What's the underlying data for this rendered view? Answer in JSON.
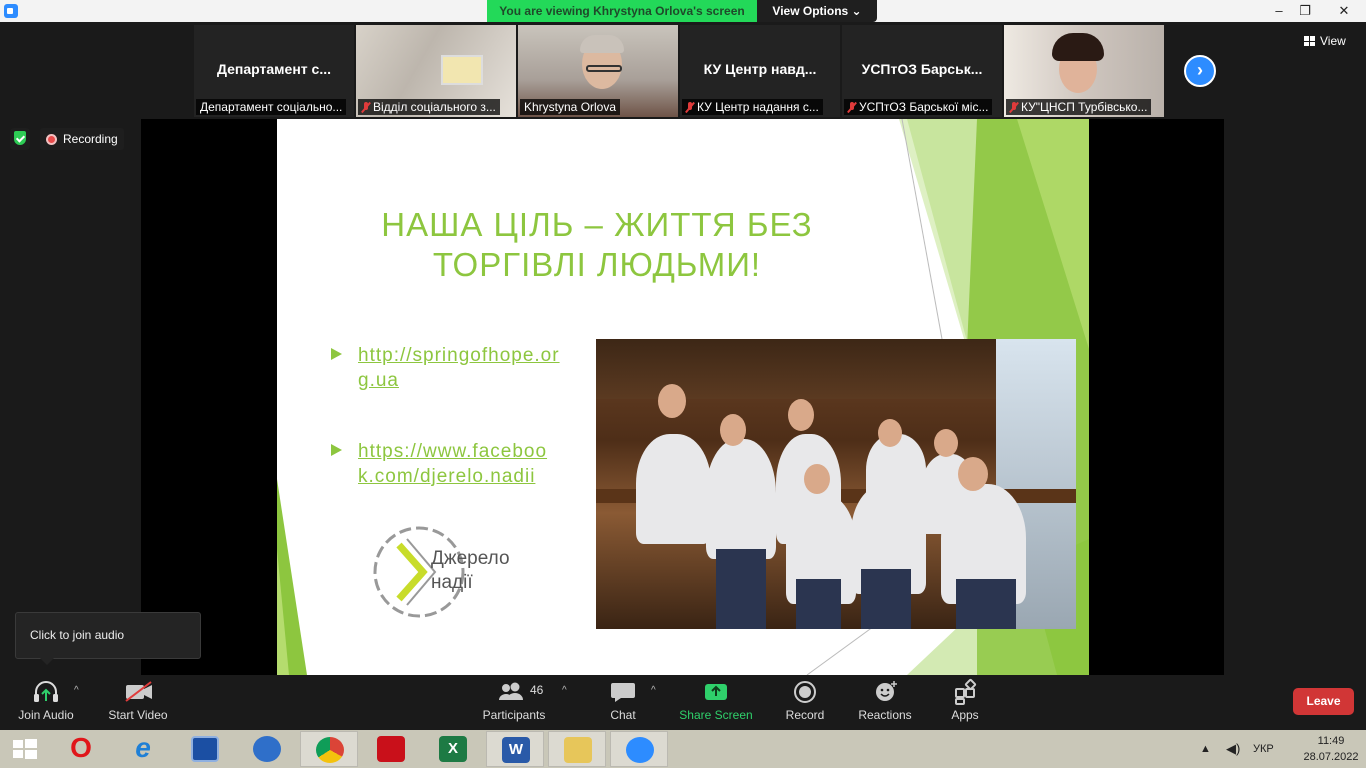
{
  "window": {
    "viewing_banner": "You are viewing Khrystyna Orlova's screen",
    "view_options": "View Options ⌄",
    "minimize": "–",
    "restore": "❐",
    "close": "✕"
  },
  "participants": [
    {
      "title": "Департамент с...",
      "name": "Департамент соціально...",
      "muted": false,
      "has_video": false
    },
    {
      "title": "",
      "name": "Відділ соціального з...",
      "muted": true,
      "has_video": true
    },
    {
      "title": "",
      "name": "Khrystyna Orlova",
      "muted": false,
      "has_video": true,
      "active": true
    },
    {
      "title": "КУ Центр навд...",
      "name": "КУ Центр надання с...",
      "muted": true,
      "has_video": false
    },
    {
      "title": "УСПтОЗ  Барськ...",
      "name": "УСПтОЗ Барської міс...",
      "muted": true,
      "has_video": false
    },
    {
      "title": "",
      "name": "КУ\"ЦНСП Турбівсько...",
      "muted": true,
      "has_video": true
    }
  ],
  "view_button": "View",
  "next_icon": "›",
  "recording_label": "Recording",
  "slide": {
    "title": "НАША ЦІЛЬ – ЖИТТЯ БЕЗ ТОРГІВЛІ ЛЮДЬМИ!",
    "bullets": [
      "http://springofhope.org.ua",
      "https://www.facebook.com/djerelo.nadii"
    ],
    "logo_line1": "Джерело",
    "logo_line2": "надії",
    "accent_color": "#8dc63f"
  },
  "tooltip": "Click to join audio",
  "toolbar": {
    "join_audio": "Join Audio",
    "start_video": "Start Video",
    "participants_label": "Participants",
    "participants_count": "46",
    "chat": "Chat",
    "share_screen": "Share Screen",
    "record": "Record",
    "reactions": "Reactions",
    "apps": "Apps",
    "leave": "Leave",
    "caret": "^"
  },
  "taskbar": {
    "language": "УКР",
    "time": "11:49",
    "date": "28.07.2022",
    "excel_letter": "X",
    "word_letter": "W",
    "opera_letter": "O",
    "ie_letter": "e"
  }
}
